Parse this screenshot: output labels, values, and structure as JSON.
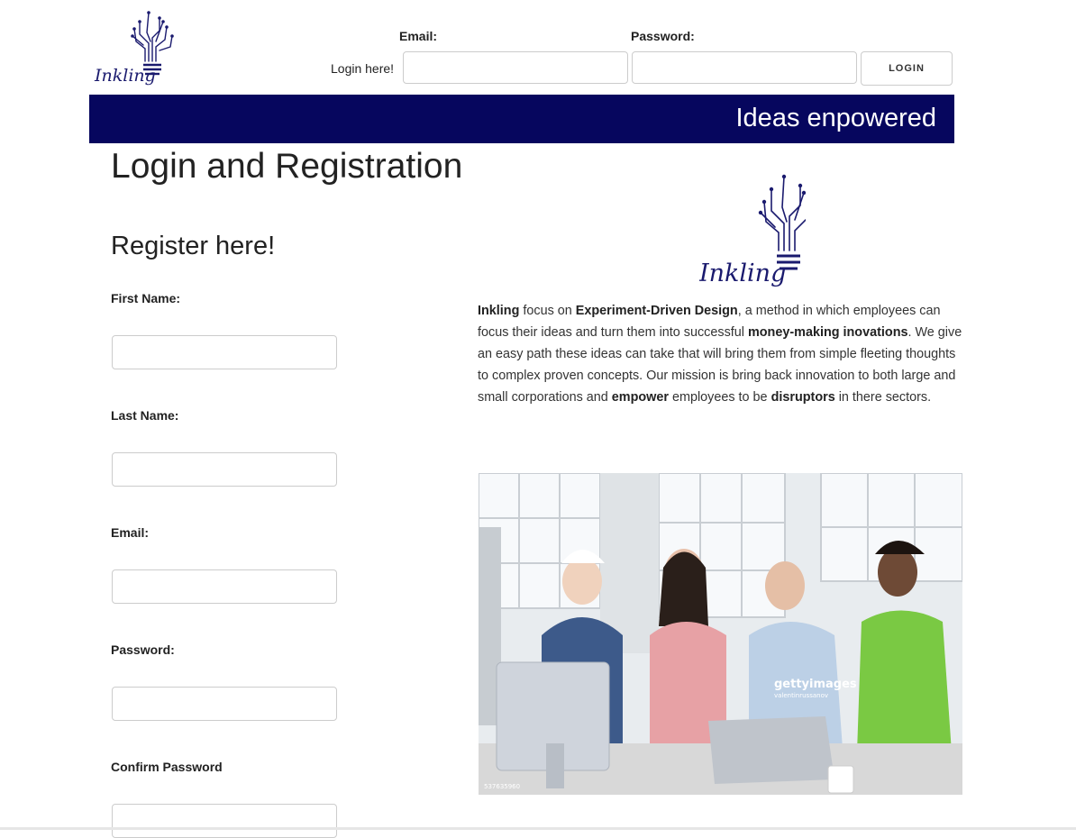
{
  "header": {
    "logo_text": "Inkling",
    "email_label": "Email:",
    "password_label": "Password:",
    "login_here": "Login here!",
    "email_value": "",
    "password_value": "",
    "login_button": "LOGIN"
  },
  "banner": {
    "tagline": "Ideas enpowered",
    "color": "#06065e"
  },
  "main": {
    "title": "Login and Registration",
    "register_title": "Register here!",
    "fields": [
      {
        "label": "First Name:",
        "value": ""
      },
      {
        "label": "Last Name:",
        "value": ""
      },
      {
        "label": "Email:",
        "value": ""
      },
      {
        "label": "Password:",
        "value": ""
      },
      {
        "label": "Confirm Password",
        "value": ""
      }
    ]
  },
  "about": {
    "logo_text": "Inkling",
    "parts": [
      {
        "text": "Inkling",
        "bold": true
      },
      {
        "text": " focus on ",
        "bold": false
      },
      {
        "text": "Experiment-Driven Design",
        "bold": true
      },
      {
        "text": ", a method in which employees can focus their ideas and turn them into successful ",
        "bold": false
      },
      {
        "text": "money-making inovations",
        "bold": true
      },
      {
        "text": ". We give an easy path these ideas can take that will bring them from simple fleeting thoughts to complex proven concepts. Our mission is bring back innovation to both large and small corporations and ",
        "bold": false
      },
      {
        "text": "empower",
        "bold": true
      },
      {
        "text": " employees to be ",
        "bold": false
      },
      {
        "text": "disruptors",
        "bold": true
      },
      {
        "text": " in there sectors.",
        "bold": false
      }
    ]
  },
  "photo": {
    "watermark": "gettyimages",
    "watermark_credit": "valentinrussanov",
    "code": "537635960"
  },
  "colors": {
    "brand": "#06065e",
    "logo": "#1a1a6e"
  }
}
